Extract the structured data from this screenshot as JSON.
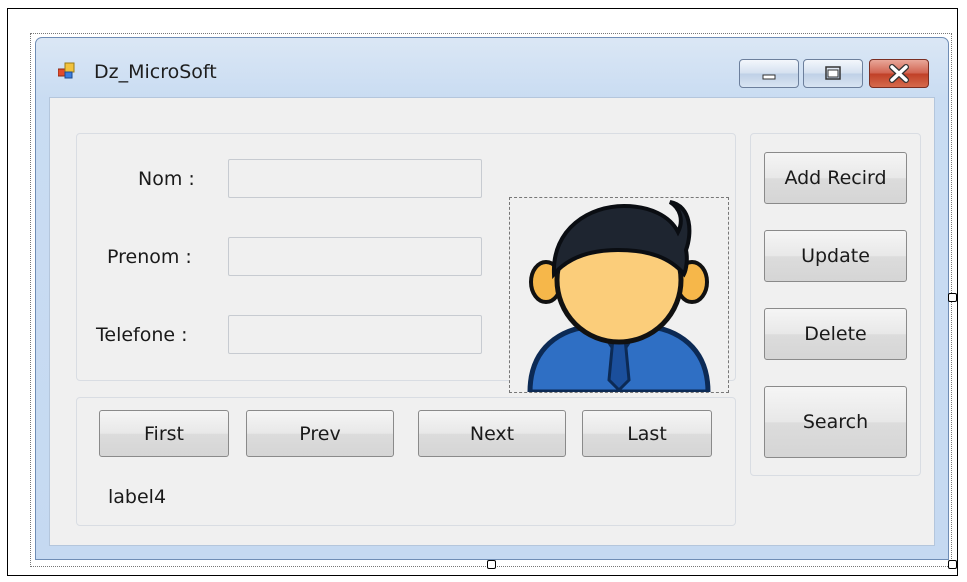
{
  "window": {
    "title": "Dz_MicroSoft"
  },
  "caption_buttons": {
    "minimize": "minimize-icon",
    "maximize": "maximize-icon",
    "close": "close-icon"
  },
  "form": {
    "fields": [
      {
        "label": "Nom :",
        "value": ""
      },
      {
        "label": "Prenom :",
        "value": ""
      },
      {
        "label": "Telefone :",
        "value": ""
      }
    ],
    "picture": "user-avatar-icon"
  },
  "nav": {
    "first": "First",
    "prev": "Prev",
    "next": "Next",
    "last": "Last",
    "status_label": "label4"
  },
  "actions": {
    "add": "Add Recird",
    "update": "Update",
    "delete": "Delete",
    "search": "Search"
  }
}
